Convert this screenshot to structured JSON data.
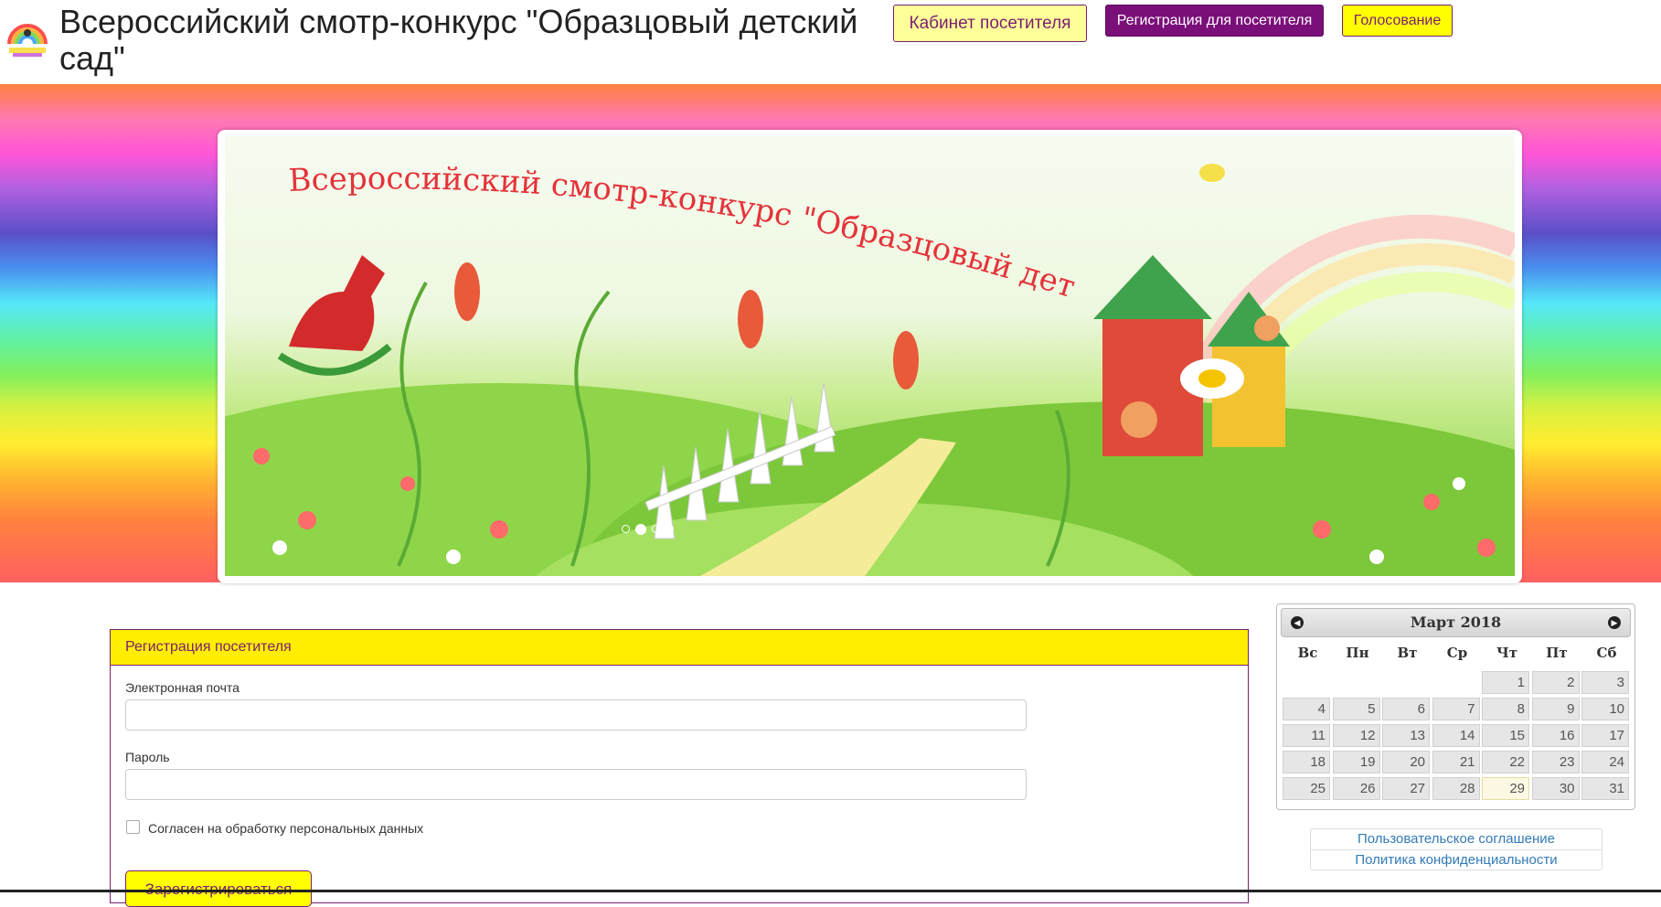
{
  "header": {
    "title": "Всероссийский смотр-конкурс \"Образцовый детский сад\"",
    "buttons": {
      "cabinet": "Кабинет посетителя",
      "register": "Регистрация для посетителя",
      "vote": "Голосование"
    }
  },
  "banner": {
    "title": "Всероссийский смотр-конкурс \"Образцовый детский сад\"",
    "slide_count": 4,
    "active_slide": 2
  },
  "form": {
    "heading": "Регистрация посетителя",
    "email_label": "Электронная почта",
    "email_value": "",
    "password_label": "Пароль",
    "password_value": "",
    "consent_label": "Согласен на обработку персональных данных",
    "consent_checked": false,
    "submit_label": "Зарегистрироваться"
  },
  "calendar": {
    "month_title": "Март 2018",
    "weekdays": [
      "Вс",
      "Пн",
      "Вт",
      "Ср",
      "Чт",
      "Пт",
      "Сб"
    ],
    "first_weekday_index": 4,
    "days_in_month": 31,
    "today": 29
  },
  "footer_links": {
    "agreement": "Пользовательское соглашение",
    "privacy": "Политика конфиденциальности"
  },
  "colors": {
    "accent_purple": "#7a0f79",
    "accent_yellow": "#ffff00"
  }
}
